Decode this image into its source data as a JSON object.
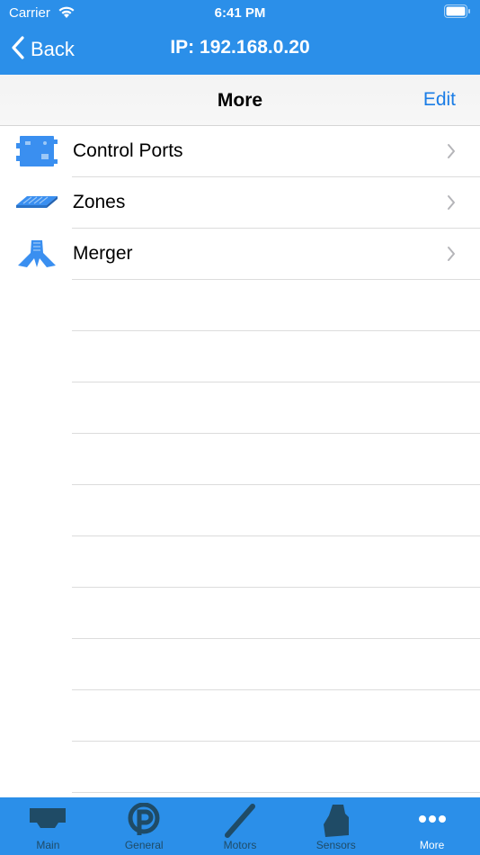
{
  "status_bar": {
    "carrier": "Carrier",
    "time": "6:41 PM"
  },
  "nav": {
    "back_label": "Back",
    "title": "IP: 192.168.0.20"
  },
  "more_header": {
    "title": "More",
    "edit_label": "Edit"
  },
  "list": {
    "items": [
      {
        "label": "Control Ports",
        "icon": "control-ports-icon"
      },
      {
        "label": "Zones",
        "icon": "zones-icon"
      },
      {
        "label": "Merger",
        "icon": "merger-icon"
      }
    ]
  },
  "tab_bar": {
    "tabs": [
      {
        "label": "Main",
        "icon": "main-icon"
      },
      {
        "label": "General",
        "icon": "general-icon"
      },
      {
        "label": "Motors",
        "icon": "motors-icon"
      },
      {
        "label": "Sensors",
        "icon": "sensors-icon"
      },
      {
        "label": "More",
        "icon": "more-dots-icon",
        "active": true
      }
    ]
  },
  "colors": {
    "brand_blue": "#2b8fe9",
    "link_blue": "#1b7de6",
    "inactive_tab": "#1f4b66",
    "active_tab": "#ffffff"
  }
}
